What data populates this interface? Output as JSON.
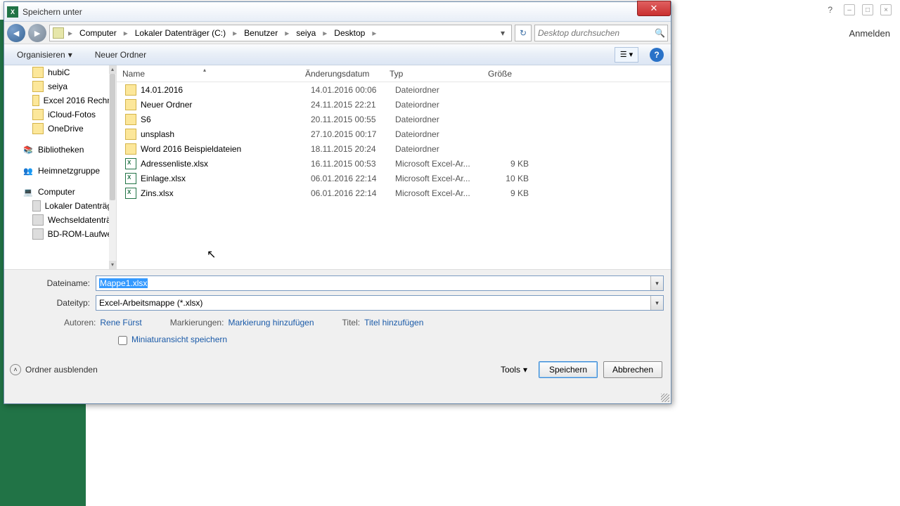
{
  "bg": {
    "login": "Anmelden"
  },
  "dialog": {
    "title": "Speichern unter",
    "breadcrumb": [
      "Computer",
      "Lokaler Datenträger (C:)",
      "Benutzer",
      "seiya",
      "Desktop"
    ],
    "search_placeholder": "Desktop durchsuchen",
    "toolbar": {
      "organize": "Organisieren",
      "new_folder": "Neuer Ordner"
    },
    "tree": [
      {
        "label": "hubiC",
        "icon": "folder",
        "lvl": 2
      },
      {
        "label": "seiya",
        "icon": "folder",
        "lvl": 2
      },
      {
        "label": "Excel 2016 Rechn",
        "icon": "folder",
        "lvl": 2
      },
      {
        "label": "iCloud-Fotos",
        "icon": "folder",
        "lvl": 2
      },
      {
        "label": "OneDrive",
        "icon": "folder",
        "lvl": 2
      },
      {
        "spacer": true
      },
      {
        "label": "Bibliotheken",
        "icon": "lib",
        "lvl": 1
      },
      {
        "spacer": true
      },
      {
        "label": "Heimnetzgruppe",
        "icon": "net",
        "lvl": 1
      },
      {
        "spacer": true
      },
      {
        "label": "Computer",
        "icon": "comp",
        "lvl": 1
      },
      {
        "label": "Lokaler Datenträg",
        "icon": "drive",
        "lvl": 2
      },
      {
        "label": "Wechseldatenträ",
        "icon": "drive",
        "lvl": 2
      },
      {
        "label": "BD-ROM-Laufwe",
        "icon": "drive",
        "lvl": 2
      }
    ],
    "columns": {
      "name": "Name",
      "date": "Änderungsdatum",
      "type": "Typ",
      "size": "Größe"
    },
    "files": [
      {
        "name": "14.01.2016",
        "date": "14.01.2016 00:06",
        "type": "Dateiordner",
        "size": "",
        "icon": "folder"
      },
      {
        "name": "Neuer Ordner",
        "date": "24.11.2015 22:21",
        "type": "Dateiordner",
        "size": "",
        "icon": "folder"
      },
      {
        "name": "S6",
        "date": "20.11.2015 00:55",
        "type": "Dateiordner",
        "size": "",
        "icon": "folder"
      },
      {
        "name": "unsplash",
        "date": "27.10.2015 00:17",
        "type": "Dateiordner",
        "size": "",
        "icon": "folder"
      },
      {
        "name": "Word 2016 Beispieldateien",
        "date": "18.11.2015 20:24",
        "type": "Dateiordner",
        "size": "",
        "icon": "folder"
      },
      {
        "name": "Adressenliste.xlsx",
        "date": "16.11.2015 00:53",
        "type": "Microsoft Excel-Ar...",
        "size": "9 KB",
        "icon": "excel"
      },
      {
        "name": "Einlage.xlsx",
        "date": "06.01.2016 22:14",
        "type": "Microsoft Excel-Ar...",
        "size": "10 KB",
        "icon": "excel"
      },
      {
        "name": "Zins.xlsx",
        "date": "06.01.2016 22:14",
        "type": "Microsoft Excel-Ar...",
        "size": "9 KB",
        "icon": "excel"
      }
    ],
    "form": {
      "filename_label": "Dateiname:",
      "filename_value": "Mappe1.xlsx",
      "filetype_label": "Dateityp:",
      "filetype_value": "Excel-Arbeitsmappe (*.xlsx)",
      "authors_label": "Autoren:",
      "authors_value": "Rene Fürst",
      "tags_label": "Markierungen:",
      "tags_value": "Markierung hinzufügen",
      "title_label": "Titel:",
      "title_value": "Titel hinzufügen",
      "thumb_label": "Miniaturansicht speichern"
    },
    "footer": {
      "hide_folders": "Ordner ausblenden",
      "tools": "Tools",
      "save": "Speichern",
      "cancel": "Abbrechen"
    }
  }
}
